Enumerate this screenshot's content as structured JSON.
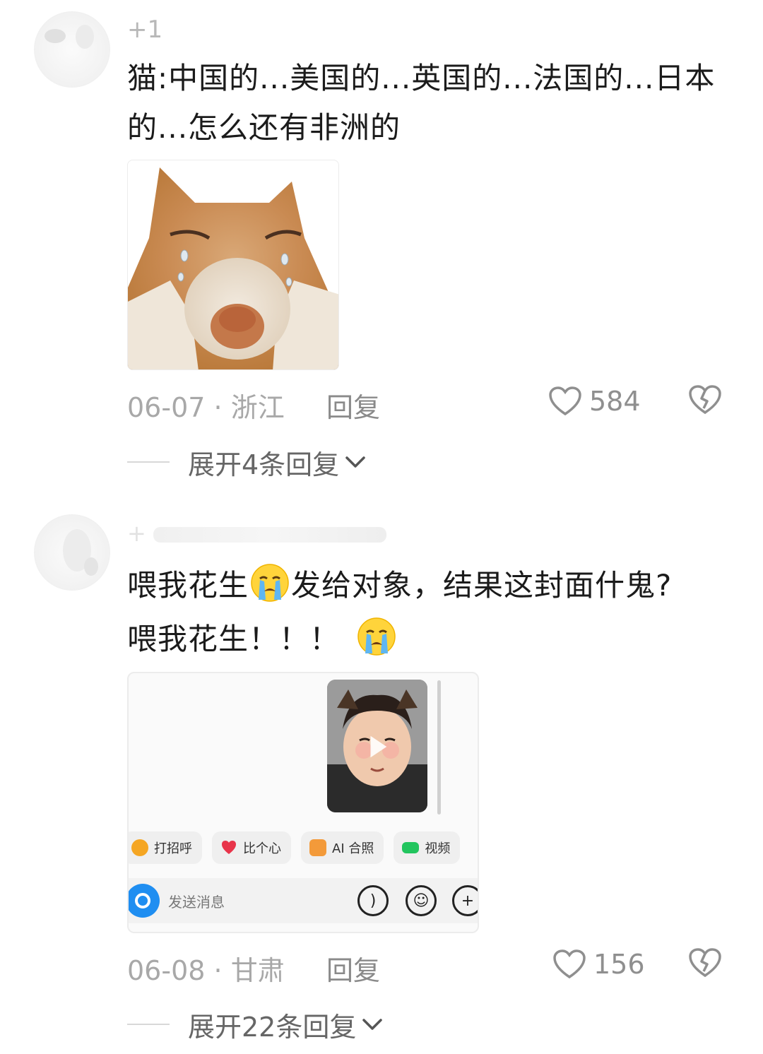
{
  "comments": [
    {
      "username": "+1",
      "text_line1": "猫:中国的...美国的...英国的...法国的...日本",
      "text_line2": "的...怎么还有非洲的",
      "date": "06-07",
      "region": "浙江",
      "date_sep": "·",
      "reply_label": "回复",
      "likes": "584",
      "expand_label": "展开4条回复"
    },
    {
      "username": "+",
      "text_line1_a": "喂我花生",
      "text_line1_b": "发给对象，结果这封面什鬼?",
      "text_line2": "喂我花生！！！",
      "date": "06-08",
      "region": "甘肃",
      "date_sep": "·",
      "reply_label": "回复",
      "likes": "156",
      "expand_label": "展开22条回复",
      "screenshot": {
        "chips": [
          {
            "label": "打招呼",
            "icon": "wave-emoji-icon",
            "color": "#f5a623"
          },
          {
            "label": "比个心",
            "icon": "heart-icon",
            "color": "#e8344a"
          },
          {
            "label": "AI 合照",
            "icon": "ai-photo-icon",
            "color": "#f39a3a"
          },
          {
            "label": "视频",
            "icon": "video-call-icon",
            "color": "#22c55e"
          }
        ],
        "input_placeholder": "发送消息"
      }
    }
  ],
  "colors": {
    "text": "#1b1b1b",
    "muted": "#a8a8a8",
    "accent_blue": "#1f8ef1"
  }
}
